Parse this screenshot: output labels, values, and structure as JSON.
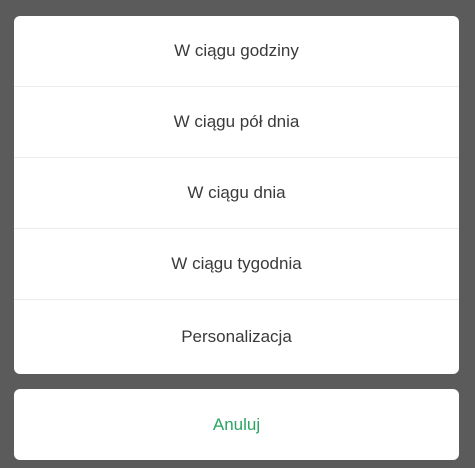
{
  "options": [
    {
      "label": "W ciągu godziny"
    },
    {
      "label": "W ciągu pół dnia"
    },
    {
      "label": "W ciągu dnia"
    },
    {
      "label": "W ciągu tygodnia"
    },
    {
      "label": "Personalizacja"
    }
  ],
  "cancel": {
    "label": "Anuluj"
  },
  "colors": {
    "overlay": "#5b5b5b",
    "sheet": "#ffffff",
    "option_text": "#3a3a3a",
    "cancel_text": "#2aa562",
    "divider": "#ececec"
  }
}
